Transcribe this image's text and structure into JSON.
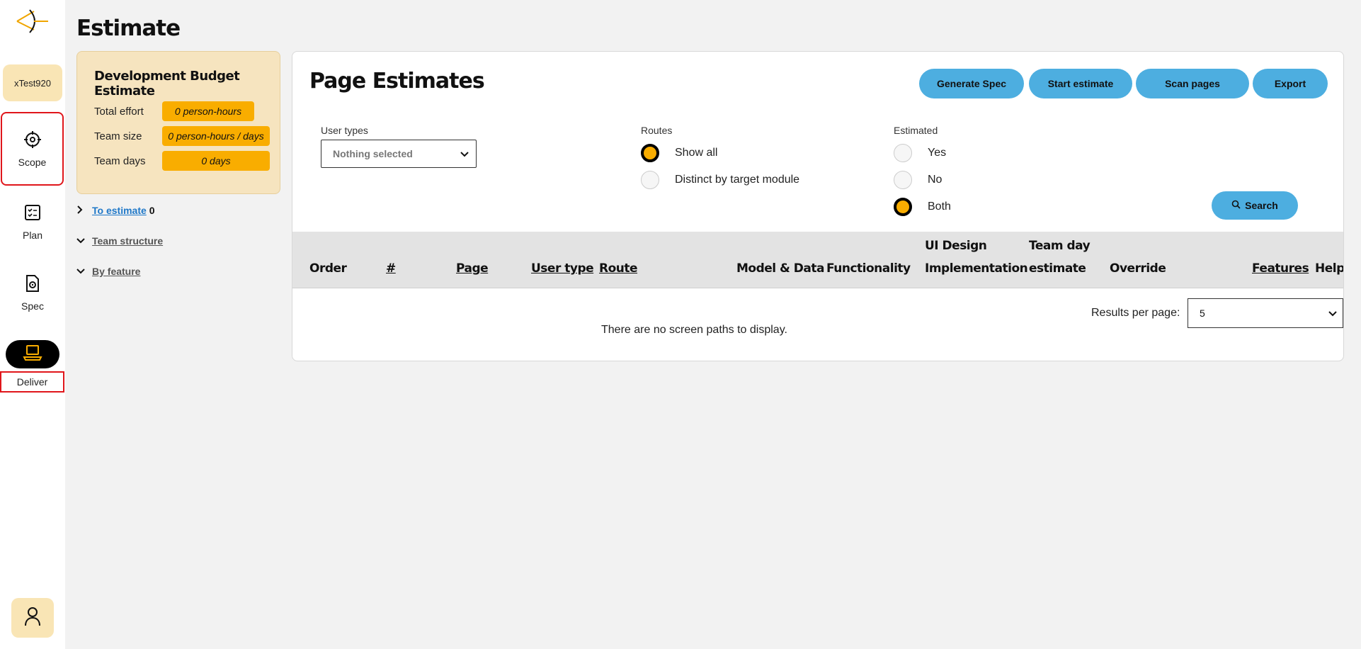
{
  "app": {
    "project_name": "xTest920"
  },
  "nav": {
    "scope": "Scope",
    "plan": "Plan",
    "spec": "Spec",
    "deliver": "Deliver"
  },
  "page": {
    "title": "Estimate"
  },
  "budget": {
    "title": "Development Budget Estimate",
    "rows": [
      {
        "label": "Total effort",
        "value": "0 person-hours"
      },
      {
        "label": "Team size",
        "value": "0 person-hours / days"
      },
      {
        "label": "Team days",
        "value": "0 days"
      }
    ]
  },
  "tree": {
    "to_estimate": "To estimate ",
    "to_estimate_count": "0",
    "team_structure": "Team structure",
    "by_feature": "By feature"
  },
  "panel": {
    "title": "Page Estimates",
    "buttons": {
      "generate_spec": "Generate Spec",
      "start_estimate": "Start estimate",
      "scan_pages": "Scan pages",
      "export": "Export"
    },
    "filters": {
      "user_types_label": "User types",
      "user_types_value": "Nothing selected",
      "routes_label": "Routes",
      "routes_options": [
        "Show all",
        "Distinct by target module"
      ],
      "routes_selected": "Show all",
      "estimated_label": "Estimated",
      "estimated_options": [
        "Yes",
        "No",
        "Both"
      ],
      "estimated_selected": "Both",
      "search": "Search"
    },
    "table": {
      "columns": [
        "Order",
        "#",
        "Page",
        "User type",
        "Route",
        "Model & Data",
        "Functionality",
        "UI Design",
        "Implementation",
        "Team day",
        "estimate",
        "Override",
        "Features",
        "Help"
      ],
      "empty_message": "There are no screen paths to display.",
      "results_per_page_label": "Results per page:",
      "results_per_page_value": "5"
    }
  },
  "colors": {
    "accent": "#f9ad00",
    "button": "#4daee0",
    "highlight": "#e0161b",
    "badge": "#f9e5b5"
  }
}
